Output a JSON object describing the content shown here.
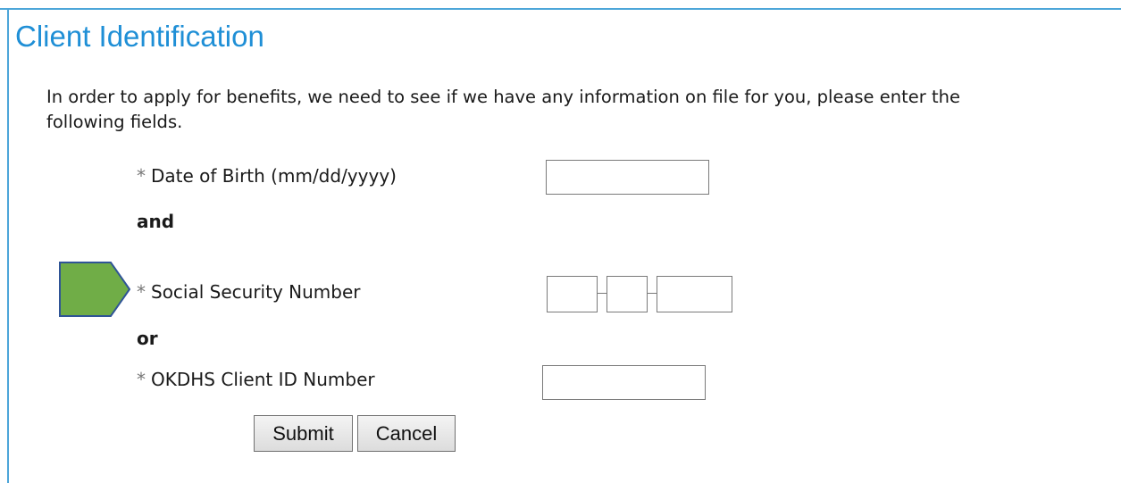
{
  "page": {
    "title": "Client Identification",
    "intro_line1": "In order to apply for benefits, we need to see if we have any information on file for you, please enter the",
    "intro_line2": "following fields."
  },
  "form": {
    "required_marker": "*",
    "dob": {
      "label": "Date of Birth (mm/dd/yyyy)",
      "value": ""
    },
    "and_text": "and",
    "ssn": {
      "label": "Social Security Number",
      "part1": "",
      "part2": "",
      "part3": ""
    },
    "or_text": "or",
    "client_id": {
      "label": "OKDHS Client ID Number",
      "value": ""
    },
    "submit_label": "Submit",
    "cancel_label": "Cancel"
  },
  "annotation": {
    "arrow_color": "#70ad47",
    "arrow_border": "#2f5496"
  },
  "colors": {
    "title": "#1f8fd6",
    "border": "#4da6d9"
  }
}
